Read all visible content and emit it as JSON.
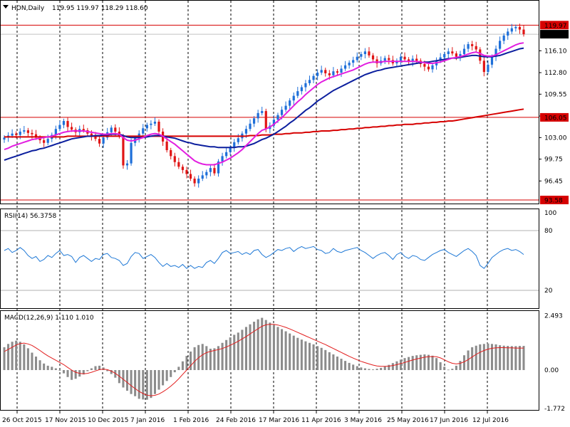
{
  "header": {
    "symbol_text": "HON,Daily",
    "ohlc_text": "119.95 119.97 118.29 118.60"
  },
  "colors": {
    "bull": "#1e6fd9",
    "bear": "#e01515",
    "ma_fast": "#e21ee0",
    "ma_mid": "#0c1f9e",
    "ma_slow": "#d60000",
    "hline": "#d60000",
    "rsi": "#1e78d6",
    "macd_hist": "#8c8c8c",
    "macd_signal": "#e21e1e"
  },
  "chart_data": [
    {
      "type": "line",
      "title": "HON,Daily",
      "ylim": [
        93.4,
        121.4
      ],
      "price_ticks": [
        "116.10",
        "112.80",
        "109.55",
        "106.25",
        "103.00",
        "99.75",
        "96.45"
      ],
      "highlight_levels": [
        {
          "label": "119.97",
          "value": 119.97,
          "style": "red-box"
        },
        {
          "label": "118.60",
          "value": 118.6,
          "style": "black-box"
        },
        {
          "label": "106.05",
          "value": 106.05,
          "style": "red-box"
        },
        {
          "label": "93.58",
          "value": 93.58,
          "style": "red-box"
        }
      ],
      "x_labels": [
        "26 Oct 2015",
        "17 Nov 2015",
        "10 Dec 2015",
        "7 Jan 2016",
        "1 Feb 2016",
        "24 Feb 2016",
        "17 Mar 2016",
        "11 Apr 2016",
        "3 May 2016",
        "25 May 2016",
        "17 Jun 2016",
        "12 Jul 2016"
      ],
      "close": [
        103.0,
        103.3,
        103.6,
        103.4,
        103.9,
        104.1,
        103.7,
        103.5,
        103.0,
        102.6,
        102.2,
        102.8,
        103.4,
        104.3,
        104.9,
        105.5,
        104.6,
        104.2,
        103.8,
        104.3,
        104.1,
        103.6,
        103.2,
        102.8,
        102.1,
        103.0,
        103.8,
        104.5,
        103.9,
        103.2,
        98.8,
        99.1,
        102.2,
        102.9,
        103.6,
        104.4,
        104.9,
        105.1,
        105.4,
        103.9,
        102.4,
        101.1,
        100.2,
        99.3,
        98.6,
        98.1,
        97.5,
        96.8,
        96.1,
        96.8,
        97.3,
        97.8,
        98.4,
        97.6,
        99.4,
        100.2,
        100.8,
        101.5,
        102.3,
        102.9,
        103.6,
        104.3,
        105.1,
        105.9,
        106.7,
        107.0,
        104.3,
        104.8,
        105.7,
        106.4,
        107.2,
        107.8,
        108.6,
        109.3,
        110.0,
        110.6,
        111.2,
        111.7,
        112.3,
        112.8,
        113.2,
        112.7,
        112.4,
        113.0,
        112.8,
        113.4,
        113.9,
        114.3,
        114.7,
        115.2,
        115.6,
        116.0,
        115.4,
        114.8,
        114.2,
        114.6,
        115.0,
        114.7,
        114.2,
        114.6,
        115.2,
        114.8,
        114.4,
        114.9,
        114.6,
        114.1,
        113.7,
        113.3,
        113.9,
        114.6,
        115.1,
        115.6,
        116.0,
        115.7,
        115.2,
        115.6,
        116.4,
        117.1,
        116.8,
        116.3,
        114.6,
        112.9,
        114.0,
        115.2,
        116.4,
        117.6,
        118.4,
        119.0,
        119.5,
        119.7,
        119.3,
        118.6
      ],
      "ma_fast": [
        101.2,
        101.4,
        101.7,
        101.9,
        102.1,
        102.3,
        102.5,
        102.7,
        102.8,
        102.9,
        103.0,
        103.1,
        103.2,
        103.4,
        103.6,
        103.8,
        103.9,
        104.0,
        104.0,
        104.0,
        104.0,
        103.9,
        103.8,
        103.7,
        103.6,
        103.5,
        103.5,
        103.6,
        103.6,
        103.5,
        103.0,
        102.6,
        102.5,
        102.6,
        102.8,
        103.0,
        103.3,
        103.5,
        103.6,
        103.5,
        103.2,
        102.8,
        102.4,
        102.0,
        101.5,
        101.0,
        100.5,
        100.0,
        99.5,
        99.2,
        99.0,
        98.9,
        98.9,
        98.9,
        99.1,
        99.3,
        99.6,
        99.9,
        100.3,
        100.7,
        101.2,
        101.8,
        102.4,
        103.0,
        103.6,
        104.1,
        104.3,
        104.6,
        105.0,
        105.5,
        106.0,
        106.6,
        107.2,
        107.8,
        108.4,
        108.9,
        109.5,
        110.0,
        110.5,
        111.0,
        111.4,
        111.7,
        112.0,
        112.2,
        112.4,
        112.6,
        112.8,
        113.0,
        113.2,
        113.5,
        113.8,
        114.1,
        114.3,
        114.4,
        114.4,
        114.4,
        114.5,
        114.5,
        114.5,
        114.5,
        114.5,
        114.5,
        114.5,
        114.5,
        114.5,
        114.4,
        114.3,
        114.2,
        114.2,
        114.3,
        114.4,
        114.6,
        114.8,
        115.0,
        115.1,
        115.2,
        115.4,
        115.6,
        115.8,
        115.9,
        115.7,
        115.4,
        115.3,
        115.3,
        115.5,
        115.8,
        116.1,
        116.4,
        116.7,
        117.0,
        117.2,
        117.3
      ],
      "ma_mid": [
        99.6,
        99.8,
        100.0,
        100.2,
        100.4,
        100.6,
        100.8,
        101.0,
        101.1,
        101.3,
        101.4,
        101.6,
        101.8,
        102.0,
        102.2,
        102.4,
        102.6,
        102.8,
        102.9,
        103.0,
        103.1,
        103.2,
        103.2,
        103.3,
        103.3,
        103.4,
        103.4,
        103.5,
        103.5,
        103.5,
        103.3,
        103.1,
        103.0,
        103.0,
        103.0,
        103.0,
        103.1,
        103.2,
        103.3,
        103.3,
        103.2,
        103.1,
        103.0,
        102.9,
        102.7,
        102.5,
        102.3,
        102.2,
        102.0,
        101.9,
        101.8,
        101.7,
        101.6,
        101.6,
        101.5,
        101.5,
        101.5,
        101.5,
        101.5,
        101.6,
        101.6,
        101.7,
        101.9,
        102.1,
        102.4,
        102.7,
        102.9,
        103.2,
        103.5,
        103.9,
        104.3,
        104.7,
        105.2,
        105.6,
        106.1,
        106.6,
        107.1,
        107.5,
        108.0,
        108.5,
        108.9,
        109.3,
        109.7,
        110.1,
        110.4,
        110.7,
        111.0,
        111.3,
        111.6,
        111.9,
        112.2,
        112.5,
        112.7,
        112.9,
        113.1,
        113.2,
        113.4,
        113.5,
        113.6,
        113.7,
        113.8,
        113.9,
        114.0,
        114.1,
        114.2,
        114.3,
        114.4,
        114.4,
        114.5,
        114.6,
        114.7,
        114.8,
        114.9,
        115.0,
        115.0,
        115.1,
        115.2,
        115.3,
        115.4,
        115.4,
        115.3,
        115.2,
        115.2,
        115.2,
        115.3,
        115.4,
        115.6,
        115.8,
        116.0,
        116.2,
        116.4,
        116.5
      ],
      "ma_slow": [
        103.1,
        103.1,
        103.1,
        103.1,
        103.1,
        103.1,
        103.1,
        103.1,
        103.1,
        103.1,
        103.1,
        103.1,
        103.1,
        103.1,
        103.1,
        103.1,
        103.2,
        103.2,
        103.2,
        103.2,
        103.2,
        103.2,
        103.2,
        103.2,
        103.2,
        103.2,
        103.2,
        103.2,
        103.2,
        103.2,
        103.2,
        103.2,
        103.2,
        103.2,
        103.2,
        103.2,
        103.2,
        103.2,
        103.2,
        103.2,
        103.2,
        103.2,
        103.2,
        103.2,
        103.2,
        103.2,
        103.2,
        103.2,
        103.2,
        103.2,
        103.2,
        103.2,
        103.2,
        103.2,
        103.2,
        103.2,
        103.2,
        103.2,
        103.2,
        103.2,
        103.2,
        103.2,
        103.3,
        103.3,
        103.3,
        103.4,
        103.4,
        103.4,
        103.5,
        103.5,
        103.5,
        103.6,
        103.6,
        103.7,
        103.7,
        103.7,
        103.8,
        103.8,
        103.9,
        103.9,
        104.0,
        104.0,
        104.0,
        104.1,
        104.1,
        104.2,
        104.2,
        104.3,
        104.3,
        104.4,
        104.4,
        104.5,
        104.5,
        104.6,
        104.6,
        104.7,
        104.7,
        104.8,
        104.8,
        104.9,
        104.9,
        105.0,
        105.0,
        105.0,
        105.1,
        105.1,
        105.2,
        105.2,
        105.3,
        105.3,
        105.4,
        105.4,
        105.5,
        105.5,
        105.6,
        105.7,
        105.8,
        105.9,
        106.0,
        106.1,
        106.2,
        106.3,
        106.4,
        106.5,
        106.6,
        106.7,
        106.8,
        106.9,
        107.0,
        107.1,
        107.2,
        107.3
      ]
    },
    {
      "type": "line",
      "title": "RSI(14) 56.3758",
      "ylim": [
        0,
        100
      ],
      "levels": [
        {
          "label": "80",
          "value": 80
        },
        {
          "label": "20",
          "value": 20
        }
      ],
      "top_label": "100",
      "values": [
        60,
        62,
        58,
        60,
        63,
        60,
        55,
        52,
        54,
        49,
        51,
        55,
        53,
        57,
        60,
        55,
        56,
        54,
        48,
        53,
        55,
        52,
        49,
        52,
        51,
        56,
        57,
        53,
        52,
        50,
        45,
        47,
        54,
        58,
        57,
        52,
        54,
        56,
        53,
        48,
        44,
        47,
        44,
        45,
        43,
        46,
        42,
        45,
        42,
        44,
        43,
        48,
        50,
        47,
        52,
        58,
        60,
        57,
        58,
        59,
        56,
        58,
        56,
        60,
        61,
        56,
        53,
        55,
        58,
        61,
        60,
        62,
        63,
        59,
        62,
        64,
        62,
        63,
        64,
        61,
        60,
        57,
        58,
        62,
        59,
        58,
        60,
        61,
        62,
        63,
        60,
        58,
        55,
        52,
        55,
        57,
        58,
        55,
        51,
        56,
        58,
        54,
        52,
        55,
        54,
        51,
        50,
        53,
        56,
        58,
        60,
        61,
        58,
        56,
        54,
        57,
        60,
        62,
        59,
        55,
        45,
        42,
        47,
        53,
        56,
        59,
        61,
        62,
        60,
        61,
        59,
        56
      ]
    },
    {
      "type": "bar",
      "title": "MACD(12,26,9) 1.110 1.010",
      "ylim": [
        -1.772,
        2.493
      ],
      "tick_labels": [
        "2.493",
        "0.00",
        "-1.772"
      ],
      "histogram": [
        1.05,
        1.2,
        1.3,
        1.35,
        1.3,
        1.18,
        1.0,
        0.8,
        0.62,
        0.45,
        0.3,
        0.2,
        0.15,
        0.08,
        0.0,
        -0.15,
        -0.32,
        -0.45,
        -0.4,
        -0.3,
        -0.2,
        -0.05,
        0.08,
        0.18,
        0.2,
        0.12,
        -0.05,
        -0.18,
        -0.35,
        -0.6,
        -0.8,
        -0.95,
        -1.1,
        -1.2,
        -1.32,
        -1.35,
        -1.36,
        -1.28,
        -1.1,
        -0.9,
        -0.7,
        -0.5,
        -0.32,
        -0.1,
        0.15,
        0.4,
        0.65,
        0.85,
        1.05,
        1.15,
        1.2,
        1.1,
        0.98,
        1.0,
        1.1,
        1.25,
        1.38,
        1.5,
        1.62,
        1.72,
        1.85,
        1.98,
        2.1,
        2.22,
        2.33,
        2.4,
        2.3,
        2.18,
        2.08,
        1.98,
        1.88,
        1.78,
        1.68,
        1.58,
        1.48,
        1.4,
        1.32,
        1.25,
        1.18,
        1.1,
        1.02,
        0.92,
        0.82,
        0.72,
        0.62,
        0.52,
        0.42,
        0.33,
        0.25,
        0.18,
        0.12,
        0.08,
        0.05,
        0.03,
        0.06,
        0.1,
        0.16,
        0.24,
        0.32,
        0.4,
        0.48,
        0.55,
        0.6,
        0.65,
        0.68,
        0.7,
        0.72,
        0.7,
        0.66,
        0.55,
        0.36,
        0.15,
        0.02,
        0.06,
        0.2,
        0.42,
        0.68,
        0.9,
        1.05,
        1.12,
        1.18,
        1.2,
        1.22,
        1.2,
        1.18,
        1.14,
        1.12,
        1.11,
        1.1,
        1.1,
        1.11,
        1.11
      ],
      "signal": [
        0.85,
        0.95,
        1.05,
        1.15,
        1.22,
        1.24,
        1.2,
        1.13,
        1.02,
        0.9,
        0.77,
        0.65,
        0.55,
        0.45,
        0.35,
        0.25,
        0.12,
        0.0,
        -0.1,
        -0.15,
        -0.17,
        -0.15,
        -0.1,
        -0.04,
        0.02,
        0.04,
        0.02,
        -0.05,
        -0.15,
        -0.28,
        -0.42,
        -0.57,
        -0.72,
        -0.85,
        -0.98,
        -1.08,
        -1.15,
        -1.18,
        -1.16,
        -1.1,
        -1.0,
        -0.88,
        -0.74,
        -0.58,
        -0.4,
        -0.2,
        0.0,
        0.2,
        0.4,
        0.57,
        0.7,
        0.8,
        0.86,
        0.9,
        0.94,
        0.99,
        1.06,
        1.14,
        1.23,
        1.32,
        1.43,
        1.54,
        1.66,
        1.78,
        1.9,
        2.01,
        2.08,
        2.1,
        2.1,
        2.07,
        2.02,
        1.96,
        1.89,
        1.81,
        1.73,
        1.65,
        1.57,
        1.49,
        1.41,
        1.33,
        1.25,
        1.17,
        1.08,
        0.99,
        0.9,
        0.81,
        0.72,
        0.63,
        0.55,
        0.47,
        0.4,
        0.34,
        0.28,
        0.23,
        0.19,
        0.17,
        0.17,
        0.18,
        0.21,
        0.25,
        0.3,
        0.35,
        0.41,
        0.46,
        0.51,
        0.55,
        0.59,
        0.61,
        0.62,
        0.61,
        0.56,
        0.47,
        0.38,
        0.31,
        0.28,
        0.31,
        0.38,
        0.48,
        0.6,
        0.72,
        0.82,
        0.9,
        0.96,
        1.0,
        1.02,
        1.03,
        1.03,
        1.02,
        1.02,
        1.01,
        1.01,
        1.01
      ]
    }
  ]
}
